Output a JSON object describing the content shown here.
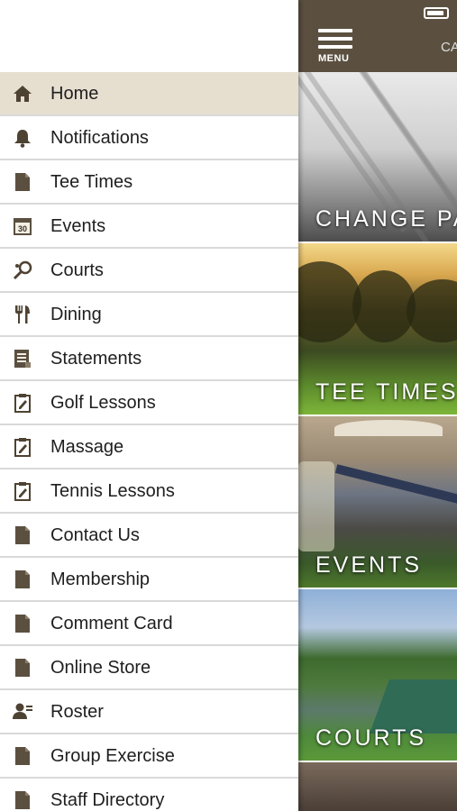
{
  "status_bar": {
    "battery_icon": "battery-icon"
  },
  "topbar": {
    "menu_label": "MENU",
    "title_cut": "CA",
    "background": "#5b5040"
  },
  "tiles": [
    {
      "label": "CHANGE PA"
    },
    {
      "label": "TEE TIMES"
    },
    {
      "label": "EVENTS"
    },
    {
      "label": "COURTS"
    },
    {
      "label": ""
    }
  ],
  "menu": {
    "active_color": "#e6dfd0",
    "icon_color": "#5b5040",
    "items": [
      {
        "label": "Home",
        "icon": "home-icon"
      },
      {
        "label": "Notifications",
        "icon": "bell-icon"
      },
      {
        "label": "Tee Times",
        "icon": "document-icon"
      },
      {
        "label": "Events",
        "icon": "calendar-icon"
      },
      {
        "label": "Courts",
        "icon": "racquet-icon"
      },
      {
        "label": "Dining",
        "icon": "utensils-icon"
      },
      {
        "label": "Statements",
        "icon": "statement-icon"
      },
      {
        "label": "Golf Lessons",
        "icon": "clipboard-edit-icon"
      },
      {
        "label": "Massage",
        "icon": "clipboard-edit-icon"
      },
      {
        "label": "Tennis Lessons",
        "icon": "clipboard-edit-icon"
      },
      {
        "label": "Contact Us",
        "icon": "document-icon"
      },
      {
        "label": "Membership",
        "icon": "document-icon"
      },
      {
        "label": "Comment Card",
        "icon": "document-icon"
      },
      {
        "label": "Online Store",
        "icon": "document-icon"
      },
      {
        "label": "Roster",
        "icon": "roster-icon"
      },
      {
        "label": "Group Exercise",
        "icon": "document-icon"
      },
      {
        "label": "Staff Directory",
        "icon": "document-icon"
      }
    ]
  }
}
